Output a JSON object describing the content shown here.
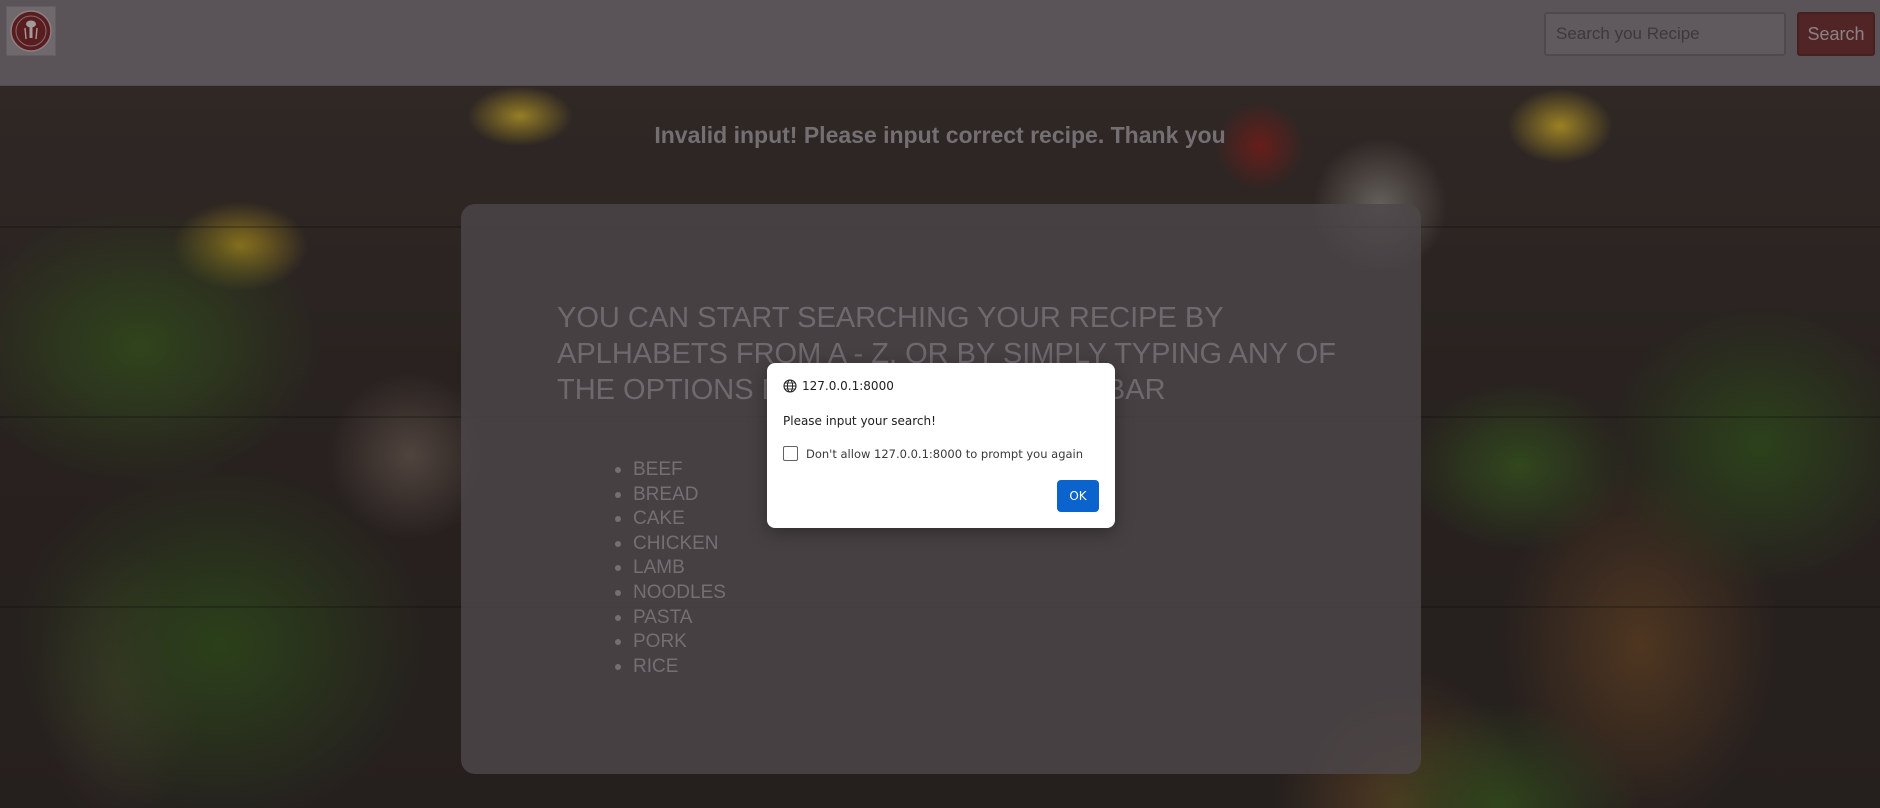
{
  "navbar": {
    "search": {
      "placeholder": "Search you Recipe",
      "value": ""
    },
    "search_label": "Search"
  },
  "main": {
    "error_message": "Invalid input! Please input correct recipe. Thank you",
    "panel": {
      "heading": "YOU CAN START SEARCHING YOUR RECIPE BY APLHABETS FROM A - Z, OR BY SIMPLY TYPING ANY OF THE OPTIONS BELOW IN THE SEARCH BAR",
      "options": [
        "BEEF",
        "BREAD",
        "CAKE",
        "CHICKEN",
        "LAMB",
        "NOODLES",
        "PASTA",
        "PORK",
        "RICE"
      ]
    }
  },
  "dialog": {
    "origin": "127.0.0.1:8000",
    "message": "Please input your search!",
    "checkbox_label": "Don't allow 127.0.0.1:8000 to prompt you again",
    "checkbox_checked": false,
    "ok_label": "OK"
  },
  "colors": {
    "navbar": "#7b7279",
    "search_button": "#6d2a2c",
    "ok_button": "#0b63ce"
  }
}
